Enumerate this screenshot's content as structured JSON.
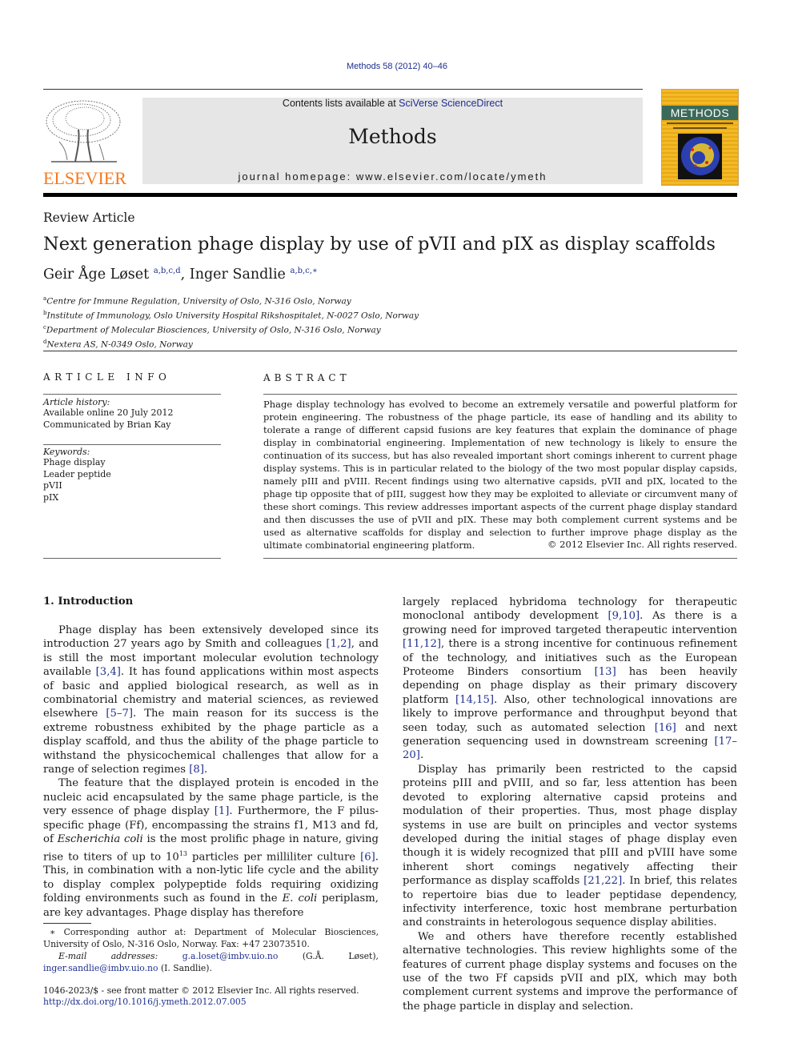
{
  "header": {
    "citation": "Methods 58 (2012) 40–46",
    "contents_prefix": "Contents lists available at ",
    "contents_link": "SciVerse ScienceDirect",
    "journal_title": "Methods",
    "homepage_label": "journal homepage: ",
    "homepage_url": "www.elsevier.com/locate/ymeth",
    "publisher_logo_text": "ELSEVIER",
    "cover_title": "METHODS",
    "colors": {
      "link": "#1f2f8f",
      "elsevier_orange": "#f47920",
      "banner_bg": "#e6e6e6",
      "cover_yellow": "#f2b928"
    }
  },
  "article": {
    "type": "Review Article",
    "title": "Next generation phage display by use of pVII and pIX as display scaffolds",
    "authors": [
      {
        "name": "Geir Åge Løset",
        "affils": "a,b,c,d",
        "sep": ", "
      },
      {
        "name": "Inger Sandlie",
        "affils": "a,b,c,∗",
        "sep": ""
      }
    ],
    "affiliations": [
      {
        "key": "a",
        "text": "Centre for Immune Regulation, University of Oslo, N-316 Oslo, Norway"
      },
      {
        "key": "b",
        "text": "Institute of Immunology, Oslo University Hospital Rikshospitalet, N-0027 Oslo, Norway"
      },
      {
        "key": "c",
        "text": "Department of Molecular Biosciences, University of Oslo, N-316 Oslo, Norway"
      },
      {
        "key": "d",
        "text": "Nextera AS, N-0349 Oslo, Norway"
      }
    ]
  },
  "article_info": {
    "heading": "ARTICLE INFO",
    "history_label": "Article history:",
    "history": [
      "Available online 20 July 2012",
      "Communicated by Brian Kay"
    ],
    "keywords_label": "Keywords:",
    "keywords": [
      "Phage display",
      "Leader peptide",
      "pVII",
      "pIX"
    ]
  },
  "abstract": {
    "heading": "ABSTRACT",
    "text": "Phage display technology has evolved to become an extremely versatile and powerful platform for protein engineering. The robustness of the phage particle, its ease of handling and its ability to tolerate a range of different capsid fusions are key features that explain the dominance of phage display in combinatorial engineering. Implementation of new technology is likely to ensure the continuation of its success, but has also revealed important short comings inherent to current phage display systems. This is in particular related to the biology of the two most popular display capsids, namely pIII and pVIII. Recent findings using two alternative capsids, pVII and pIX, located to the phage tip opposite that of pIII, suggest how they may be exploited to alleviate or circumvent many of these short comings. This review addresses important aspects of the current phage display standard and then discusses the use of pVII and pIX. These may both complement current systems and be used as alternative scaffolds for display and selection to further improve phage display as the ultimate combinatorial engineering platform.",
    "copyright": "© 2012 Elsevier Inc. All rights reserved."
  },
  "intro": {
    "heading": "1. Introduction",
    "p1": [
      {
        "t": "Phage display has been extensively developed since its introduction 27 years ago by Smith and colleagues "
      },
      {
        "c": "[1,2]"
      },
      {
        "t": ", and is still the most important molecular evolution technology available "
      },
      {
        "c": "[3,4]"
      },
      {
        "t": ". It has found applications within most aspects of basic and applied biological research, as well as in combinatorial chemistry and material sciences, as reviewed elsewhere "
      },
      {
        "c": "[5–7]"
      },
      {
        "t": ". The main reason for its success is the extreme robustness exhibited by the phage particle as a display scaffold, and thus the ability of the phage particle to withstand the physicochemical challenges that allow for a range of selection regimes "
      },
      {
        "c": "[8]"
      },
      {
        "t": "."
      }
    ],
    "p2": [
      {
        "t": "The feature that the displayed protein is encoded in the nucleic acid encapsulated by the same phage particle, is the very essence of phage display "
      },
      {
        "c": "[1]"
      },
      {
        "t": ". Furthermore, the F pilus-specific phage (Ff), encompassing the strains f1, M13 and fd, of "
      },
      {
        "i": "Escherichia coli"
      },
      {
        "t": " is the most prolific phage in nature, giving rise to titers of up to 10"
      },
      {
        "s": "13"
      },
      {
        "t": " particles per milliliter culture "
      },
      {
        "c": "[6]"
      },
      {
        "t": ". This, in combination with a non-lytic life cycle and the ability to display complex polypeptide folds requiring oxidizing folding environments such as found in the "
      },
      {
        "i": "E. coli"
      },
      {
        "t": " periplasm, are key advantages. Phage display has therefore largely replaced hybridoma technology for therapeutic monoclonal antibody development "
      },
      {
        "c": "[9,10]"
      },
      {
        "t": ". As there is a growing need for improved targeted therapeutic intervention "
      },
      {
        "c": "[11,12]"
      },
      {
        "t": ", there is a strong incentive for continuous refinement of the technology, and initiatives such as the European Proteome Binders consortium "
      },
      {
        "c": "[13]"
      },
      {
        "t": " has been heavily depending on phage display as their primary discovery platform "
      },
      {
        "c": "[14,15]"
      },
      {
        "t": ". Also, other technological innovations are likely to improve performance and throughput beyond that seen today, such as automated selection "
      },
      {
        "c": "[16]"
      },
      {
        "t": " and next generation sequencing used in downstream screening "
      },
      {
        "c": "[17–20]"
      },
      {
        "t": "."
      }
    ],
    "p3": [
      {
        "t": "Display has primarily been restricted to the capsid proteins pIII and pVIII, and so far, less attention has been devoted to exploring alternative capsid proteins and modulation of their properties. Thus, most phage display systems in use are built on principles and vector systems developed during the initial stages of phage display even though it is widely recognized that pIII and pVIII have some inherent short comings negatively affecting their performance as display scaffolds "
      },
      {
        "c": "[21,22]"
      },
      {
        "t": ". In brief, this relates to repertoire bias due to leader peptidase dependency, infectivity interference, toxic host membrane perturbation and constraints in heterologous sequence display abilities."
      }
    ],
    "p4": "We and others have therefore recently established alternative technologies. This review highlights some of the features of current phage display systems and focuses on the use of the two Ff capsids pVII and pIX, which may both complement current systems and improve the performance of the phage particle in display and selection."
  },
  "footnotes": {
    "corresponding": "∗ Corresponding author at: Department of Molecular Biosciences, University of Oslo, N-316 Oslo, Norway. Fax: +47 23073510.",
    "email_label": "E-mail addresses:",
    "email1": "g.a.loset@imbv.uio.no",
    "email1_name": " (G.Å. Løset), ",
    "email2": "inger.sandlie@imbv.uio.no",
    "email2_name": " (I. Sandlie).",
    "issn": "1046-2023/$ - see front matter © 2012 Elsevier Inc. All rights reserved.",
    "doi": "http://dx.doi.org/10.1016/j.ymeth.2012.07.005"
  }
}
